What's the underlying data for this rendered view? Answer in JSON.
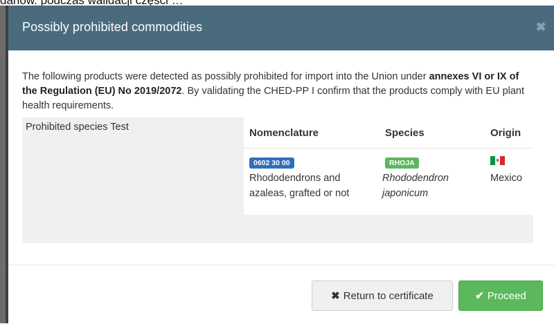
{
  "top_caption": "danów. podczas walidacji części …",
  "modal": {
    "title": "Possibly prohibited commodities",
    "close_icon": "close-icon",
    "intro": {
      "part1": "The following products were detected as possibly prohibited for import into the Union under ",
      "bold": "annexes VI or IX of the Regulation (EU) No 2019/2072",
      "part2": ". By validating the CHED-PP I confirm that the products comply with EU plant health requirements."
    },
    "panel": {
      "label": "Prohibited species Test",
      "columns": [
        "Nomenclature",
        "Species",
        "Origin"
      ],
      "row": {
        "nomenclature_code": "0602 30 00",
        "nomenclature_text_line1": "Rhododendrons and",
        "nomenclature_text_line2": "azaleas, grafted or not",
        "species_code": "RHOJA",
        "species_line1": "Rhododendron",
        "species_line2": "japonicum",
        "origin_flag": "mexico-flag-icon",
        "origin": "Mexico"
      }
    },
    "footer": {
      "return_icon": "times-icon",
      "return_label": "Return to certificate",
      "proceed_icon": "check-icon",
      "proceed_label": "Proceed"
    }
  },
  "colors": {
    "header_bg": "#4a6b7e",
    "badge_blue": "#2f6fbd",
    "badge_green": "#5cb85c",
    "proceed_green": "#5cb85c"
  }
}
